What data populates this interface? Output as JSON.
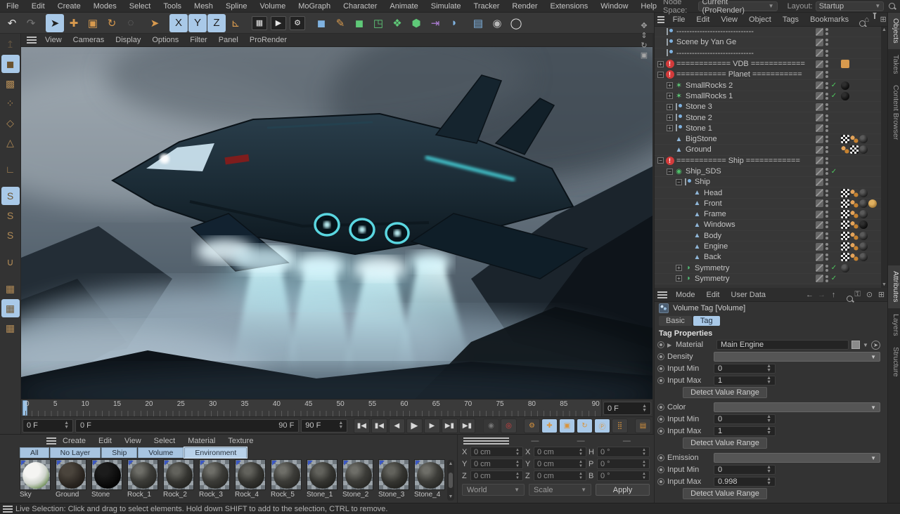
{
  "colors": {
    "accent_blue": "#a9c9e8",
    "warning_red": "#d23b3b",
    "icon_orange": "#d89a4e",
    "engine_cyan": "#7fe3f0",
    "check_green": "#4fc95f"
  },
  "menubar": {
    "items": [
      "File",
      "Edit",
      "Create",
      "Modes",
      "Select",
      "Tools",
      "Mesh",
      "Spline",
      "Volume",
      "MoGraph",
      "Character",
      "Animate",
      "Simulate",
      "Tracker",
      "Render",
      "Extensions",
      "Window",
      "Help"
    ],
    "node_space_label": "Node Space:",
    "node_space_value": "Current (ProRender)",
    "layout_label": "Layout:",
    "layout_value": "Startup"
  },
  "toolbar": {
    "icons": [
      {
        "name": "undo-icon",
        "glyph": "↶",
        "cls": "g-white"
      },
      {
        "name": "redo-icon",
        "glyph": "↷",
        "cls": "g-white dimmed",
        "dim": true
      },
      {
        "name": "sep"
      },
      {
        "name": "live-selection-icon",
        "glyph": "➤",
        "cls": "g-dark",
        "active": true
      },
      {
        "name": "move-icon",
        "glyph": "✚",
        "cls": "g-orange"
      },
      {
        "name": "scale-icon",
        "glyph": "▣",
        "cls": "g-orange"
      },
      {
        "name": "rotate-icon",
        "glyph": "↻",
        "cls": "g-orange"
      },
      {
        "name": "last-tool-icon",
        "glyph": "◌",
        "cls": "g-white",
        "dim": true
      },
      {
        "name": "sep"
      },
      {
        "name": "selection-tool-icon",
        "glyph": "➤",
        "cls": "g-orange"
      },
      {
        "name": "sep"
      },
      {
        "name": "x-axis-lock-icon",
        "glyph": "X",
        "cls": "g-dark",
        "active": true
      },
      {
        "name": "y-axis-lock-icon",
        "glyph": "Y",
        "cls": "g-dark",
        "active": true
      },
      {
        "name": "z-axis-lock-icon",
        "glyph": "Z",
        "cls": "g-dark",
        "active": true
      },
      {
        "name": "coordinate-system-icon",
        "glyph": "⊾",
        "cls": "g-orange"
      },
      {
        "name": "sep"
      },
      {
        "name": "render-view-icon",
        "glyph": "▦",
        "cls": "g-white box"
      },
      {
        "name": "render-picture-viewer-icon",
        "glyph": "▶",
        "cls": "g-white box"
      },
      {
        "name": "render-settings-icon",
        "glyph": "⚙",
        "cls": "g-white box"
      },
      {
        "name": "sep"
      },
      {
        "name": "primitive-cube-icon",
        "glyph": "◼",
        "cls": "g-blue"
      },
      {
        "name": "spline-pen-icon",
        "glyph": "✎",
        "cls": "g-orange"
      },
      {
        "name": "subdivision-surface-icon",
        "glyph": "◼",
        "cls": "g-green"
      },
      {
        "name": "instance-icon",
        "glyph": "◳",
        "cls": "g-green"
      },
      {
        "name": "mograph-icon",
        "glyph": "❖",
        "cls": "g-green"
      },
      {
        "name": "volume-builder-icon",
        "glyph": "⬢",
        "cls": "g-green"
      },
      {
        "name": "spline-boole-icon",
        "glyph": "⇥",
        "cls": "g-purple"
      },
      {
        "name": "deformer-icon",
        "glyph": "◗",
        "cls": "g-blue"
      },
      {
        "name": "sep"
      },
      {
        "name": "floor-icon",
        "glyph": "▤",
        "cls": "g-blue"
      },
      {
        "name": "camera-icon",
        "glyph": "◉",
        "cls": "g-dark2"
      },
      {
        "name": "light-icon",
        "glyph": "◯",
        "cls": "g-white"
      }
    ]
  },
  "left_modes": {
    "icons": [
      {
        "name": "make-editable-icon",
        "glyph": "↥",
        "dim": true
      },
      {
        "name": "model-mode-icon",
        "glyph": "◼",
        "active": true
      },
      {
        "name": "texture-mode-icon",
        "glyph": "▩"
      },
      {
        "name": "point-mode-icon",
        "glyph": "⁘"
      },
      {
        "name": "edge-mode-icon",
        "glyph": "◇"
      },
      {
        "name": "polygon-mode-icon",
        "glyph": "△"
      },
      {
        "name": "gap"
      },
      {
        "name": "object-axis-mode-icon",
        "glyph": "∟"
      },
      {
        "name": "gap"
      },
      {
        "name": "snap-gray-icon",
        "glyph": "S",
        "active": true
      },
      {
        "name": "snap-orange-icon",
        "glyph": "S"
      },
      {
        "name": "snap-outline-icon",
        "glyph": "S"
      },
      {
        "name": "gap"
      },
      {
        "name": "magnet-icon",
        "glyph": "∪"
      },
      {
        "name": "gap"
      },
      {
        "name": "workplane-icon",
        "glyph": "▦"
      },
      {
        "name": "locked-workplane-icon",
        "glyph": "▦",
        "active": true
      },
      {
        "name": "rotate-workplane-icon",
        "glyph": "▦"
      }
    ]
  },
  "viewport": {
    "menus": [
      "View",
      "Cameras",
      "Display",
      "Options",
      "Filter",
      "Panel",
      "ProRender"
    ],
    "nav_icons": [
      "pan-view-icon",
      "dolly-view-icon",
      "rotate-view-icon",
      "maximize-view-icon"
    ],
    "nav_glyphs": [
      "✥",
      "⇕",
      "↻",
      "▣"
    ]
  },
  "timeline": {
    "ticks": [
      "0",
      "5",
      "10",
      "15",
      "20",
      "25",
      "30",
      "35",
      "40",
      "45",
      "50",
      "55",
      "60",
      "65",
      "70",
      "75",
      "80",
      "85",
      "90"
    ],
    "frame_field": "0 F"
  },
  "transport": {
    "current_frame": "0 F",
    "range_start": "0 F",
    "range_end": "90 F",
    "end_frame": "90 F",
    "buttons": [
      {
        "name": "goto-start-button",
        "glyph": "▮◀"
      },
      {
        "name": "goto-prev-key-button",
        "glyph": "▮◀"
      },
      {
        "name": "prev-frame-button",
        "glyph": "◀"
      },
      {
        "name": "play-button",
        "glyph": "▶",
        "play": true
      },
      {
        "name": "next-frame-button",
        "glyph": "▶"
      },
      {
        "name": "goto-next-key-button",
        "glyph": "▶▮"
      },
      {
        "name": "goto-end-button",
        "glyph": "▶▮"
      }
    ],
    "record_buttons": [
      {
        "name": "record-keyframe-button",
        "glyph": "◉",
        "cls": "dim"
      },
      {
        "name": "autokeying-button",
        "glyph": "◎",
        "cls": "red"
      },
      {
        "name": "gap"
      },
      {
        "name": "keying-settings-button",
        "glyph": "⚙",
        "cls": "o"
      },
      {
        "name": "record-position-button",
        "glyph": "✚",
        "cls": "o",
        "active": true
      },
      {
        "name": "record-scale-button",
        "glyph": "▣",
        "cls": "o",
        "active": true
      },
      {
        "name": "record-rotation-button",
        "glyph": "↻",
        "cls": "o",
        "active": true
      },
      {
        "name": "record-parameter-button",
        "glyph": "Ⓟ",
        "cls": "o",
        "active": true
      },
      {
        "name": "record-pla-button",
        "glyph": "⣿",
        "cls": "o"
      },
      {
        "name": "gap"
      },
      {
        "name": "timeline-window-button",
        "glyph": "▤",
        "cls": "o"
      }
    ]
  },
  "material_manager": {
    "menus": [
      "Create",
      "Edit",
      "View",
      "Select",
      "Material",
      "Texture"
    ],
    "layer_tabs": [
      {
        "label": "All",
        "active": false
      },
      {
        "label": "No Layer",
        "active": false
      },
      {
        "label": "Ship",
        "active": false
      },
      {
        "label": "Volume",
        "active": false
      },
      {
        "label": "Environment",
        "active": true
      }
    ],
    "materials": [
      {
        "name": "Sky",
        "sphere": "sph-sky"
      },
      {
        "name": "Ground",
        "sphere": "sph-ground"
      },
      {
        "name": "Stone",
        "sphere": "sph-stone"
      },
      {
        "name": "Rock_1",
        "sphere": "sph-rock"
      },
      {
        "name": "Rock_2",
        "sphere": "sph-rock2"
      },
      {
        "name": "Rock_3",
        "sphere": "sph-rock"
      },
      {
        "name": "Rock_4",
        "sphere": "sph-rock2"
      },
      {
        "name": "Rock_5",
        "sphere": "sph-rock"
      },
      {
        "name": "Stone_1",
        "sphere": "sph-rock2"
      },
      {
        "name": "Stone_2",
        "sphere": "sph-rock"
      },
      {
        "name": "Stone_3",
        "sphere": "sph-rock2"
      },
      {
        "name": "Stone_4",
        "sphere": "sph-rock"
      }
    ]
  },
  "coordinates": {
    "headers": [
      "—",
      "—",
      "—"
    ],
    "col1": [
      {
        "axis": "X",
        "value": "0 cm"
      },
      {
        "axis": "Y",
        "value": "0 cm"
      },
      {
        "axis": "Z",
        "value": "0 cm"
      }
    ],
    "col2": [
      {
        "axis": "X",
        "value": "0 cm"
      },
      {
        "axis": "Y",
        "value": "0 cm"
      },
      {
        "axis": "Z",
        "value": "0 cm"
      }
    ],
    "col3": [
      {
        "axis": "H",
        "value": "0 °"
      },
      {
        "axis": "P",
        "value": "0 °"
      },
      {
        "axis": "B",
        "value": "0 °"
      }
    ],
    "space_dropdown": "World",
    "mode_dropdown": "Scale",
    "apply_button": "Apply"
  },
  "object_manager": {
    "menus": [
      "File",
      "Edit",
      "View",
      "Object",
      "Tags",
      "Bookmarks"
    ],
    "header_icons": [
      "search-icon",
      "home-icon",
      "filter-icon",
      "add-panel-icon"
    ],
    "objects": [
      {
        "name": "------------------------------",
        "icon": "null",
        "depth": 0,
        "tags": []
      },
      {
        "name": "Scene by Yan Ge",
        "icon": "null",
        "depth": 0,
        "tags": []
      },
      {
        "name": "------------------------------",
        "icon": "null",
        "depth": 0,
        "tags": []
      },
      {
        "name": "============ VDB ============",
        "icon": "warning",
        "depth": 0,
        "expand": "+",
        "tags": [
          "note"
        ]
      },
      {
        "name": "=========== Planet ===========",
        "icon": "warning",
        "depth": 0,
        "expand": "−",
        "tags": []
      },
      {
        "name": "SmallRocks 2",
        "icon": "matrix",
        "depth": 1,
        "expand": "+",
        "check": true,
        "tags": [
          "sphere-dk"
        ]
      },
      {
        "name": "SmallRocks 1",
        "icon": "matrix",
        "depth": 1,
        "expand": "+",
        "check": true,
        "tags": [
          "sphere-dk"
        ]
      },
      {
        "name": "Stone 3",
        "icon": "null",
        "depth": 1,
        "expand": "+",
        "tags": []
      },
      {
        "name": "Stone 2",
        "icon": "null",
        "depth": 1,
        "expand": "+",
        "tags": []
      },
      {
        "name": "Stone 1",
        "icon": "null",
        "depth": 1,
        "expand": "+",
        "tags": []
      },
      {
        "name": "BigStone",
        "icon": "poly",
        "depth": 1,
        "tags": [
          "checker",
          "uvw",
          "sphere"
        ]
      },
      {
        "name": "Ground",
        "icon": "poly",
        "depth": 1,
        "tags": [
          "uvw",
          "checker",
          "sphere"
        ]
      },
      {
        "name": "=========== Ship ============",
        "icon": "warning",
        "depth": 0,
        "expand": "−",
        "tags": []
      },
      {
        "name": "Ship_SDS",
        "icon": "sds",
        "depth": 1,
        "expand": "−",
        "check": true,
        "tags": []
      },
      {
        "name": "Ship",
        "icon": "null",
        "depth": 2,
        "expand": "−",
        "tags": []
      },
      {
        "name": "Head",
        "icon": "poly",
        "depth": 3,
        "tags": [
          "checker",
          "uvw",
          "sphere"
        ]
      },
      {
        "name": "Front",
        "icon": "poly",
        "depth": 3,
        "tags": [
          "checker",
          "uvw",
          "sphere",
          "gold"
        ]
      },
      {
        "name": "Frame",
        "icon": "poly",
        "depth": 3,
        "tags": [
          "checker",
          "uvw",
          "sphere"
        ]
      },
      {
        "name": "Windows",
        "icon": "poly",
        "depth": 3,
        "tags": [
          "checker",
          "uvw",
          "sphere-dk"
        ]
      },
      {
        "name": "Body",
        "icon": "poly",
        "depth": 3,
        "tags": [
          "checker",
          "uvw",
          "sphere"
        ]
      },
      {
        "name": "Engine",
        "icon": "poly",
        "depth": 3,
        "tags": [
          "checker",
          "uvw",
          "sphere"
        ]
      },
      {
        "name": "Back",
        "icon": "poly",
        "depth": 3,
        "tags": [
          "checker",
          "uvw",
          "sphere"
        ]
      },
      {
        "name": "Symmetry",
        "icon": "symmetry",
        "depth": 2,
        "expand": "+",
        "check": true,
        "tags": [
          "sphere"
        ]
      },
      {
        "name": "Symmetry",
        "icon": "symmetry",
        "depth": 2,
        "expand": "+",
        "check": true,
        "tags": []
      }
    ]
  },
  "attributes": {
    "menus": [
      "Mode",
      "Edit",
      "User Data"
    ],
    "title": "Volume Tag [Volume]",
    "tabs": [
      {
        "label": "Basic",
        "active": false
      },
      {
        "label": "Tag",
        "active": true
      }
    ],
    "section_header": "Tag Properties",
    "material_label": "Material",
    "material_value": "Main Engine",
    "sections": [
      {
        "dropdown_label": "Density",
        "inputs": [
          {
            "label": "Input Min",
            "value": "0"
          },
          {
            "label": "Input Max",
            "value": "1"
          }
        ],
        "button": "Detect Value Range"
      },
      {
        "dropdown_label": "Color",
        "inputs": [
          {
            "label": "Input Min",
            "value": "0"
          },
          {
            "label": "Input Max",
            "value": "1"
          }
        ],
        "button": "Detect Value Range"
      },
      {
        "dropdown_label": "Emission",
        "inputs": [
          {
            "label": "Input Min",
            "value": "0"
          },
          {
            "label": "Input Max",
            "value": "0.998"
          }
        ],
        "button": "Detect Value Range"
      }
    ]
  },
  "right_tabs_top": [
    {
      "label": "Objects",
      "active": true
    },
    {
      "label": "Takes",
      "active": false
    },
    {
      "label": "Content Browser",
      "active": false
    }
  ],
  "right_tabs_bottom": [
    {
      "label": "Attributes",
      "active": true
    },
    {
      "label": "Layers",
      "active": false
    },
    {
      "label": "Structure",
      "active": false
    }
  ],
  "status_bar": {
    "text": "Live Selection: Click and drag to select elements. Hold down SHIFT to add to the selection, CTRL to remove."
  }
}
